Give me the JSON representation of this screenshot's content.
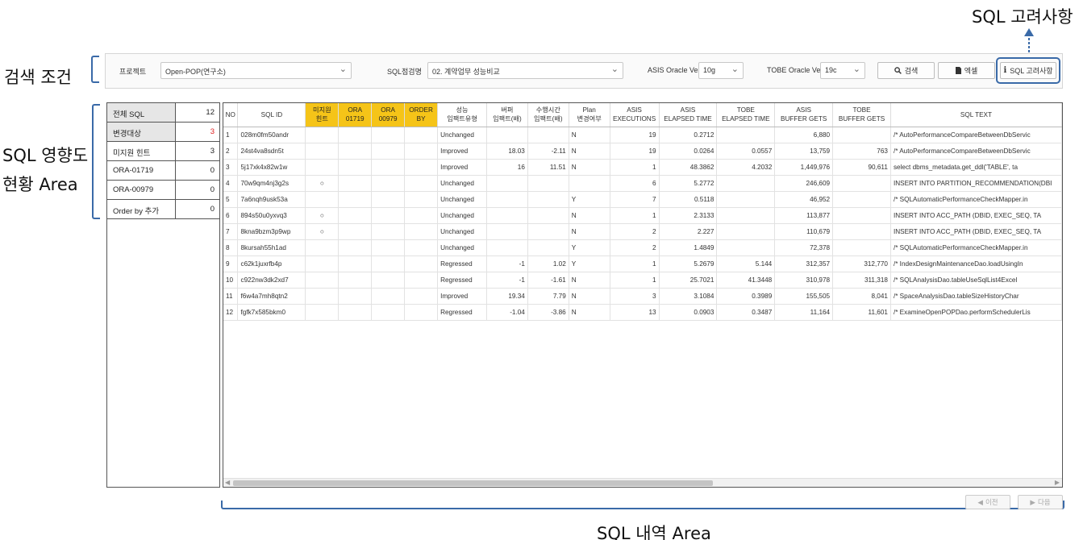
{
  "annotations": {
    "search_condition": "검색 조건",
    "sql_impact_line1": "SQL 영향도",
    "sql_impact_line2": "현황 Area",
    "sql_history": "SQL 내역 Area",
    "sql_considerations": "SQL 고려사항"
  },
  "search": {
    "project_label": "프로젝트",
    "project_value": "Open-POP(연구소)",
    "sql_check_label": "SQL점검명",
    "sql_check_value": "02. 계약업무 성능비교",
    "asis_label": "ASIS Oracle Ver.",
    "asis_value": "10g",
    "tobe_label": "TOBE Oracle Ver.",
    "tobe_value": "19c",
    "search_button": "검색",
    "excel_button": "엑셀",
    "considerations_button": "SQL 고려사항"
  },
  "summary": [
    {
      "label": "전체 SQL",
      "count": "12",
      "highlight": true,
      "count_color": "#222222"
    },
    {
      "label": "변경대상",
      "count": "3",
      "highlight": true,
      "count_color": "#e02020"
    },
    {
      "label": "미지원 힌트",
      "count": "3",
      "highlight": false,
      "count_color": "#222222"
    },
    {
      "label": "ORA-01719",
      "count": "0",
      "highlight": false,
      "count_color": "#222222"
    },
    {
      "label": "ORA-00979",
      "count": "0",
      "highlight": false,
      "count_color": "#222222"
    },
    {
      "label": "Order by 추가",
      "count": "0",
      "highlight": false,
      "count_color": "#222222"
    }
  ],
  "table": {
    "header_accent": "#f5c418",
    "columns": [
      {
        "line1": "NO",
        "line2": "",
        "highlight": false
      },
      {
        "line1": "SQL ID",
        "line2": "",
        "highlight": false
      },
      {
        "line1": "미지원",
        "line2": "힌트",
        "highlight": true
      },
      {
        "line1": "ORA",
        "line2": "01719",
        "highlight": true
      },
      {
        "line1": "ORA",
        "line2": "00979",
        "highlight": true
      },
      {
        "line1": "ORDER",
        "line2": "BY",
        "highlight": true
      },
      {
        "line1": "성능",
        "line2": "임팩트유형",
        "highlight": false
      },
      {
        "line1": "버퍼",
        "line2": "임팩트(배)",
        "highlight": false
      },
      {
        "line1": "수행시간",
        "line2": "임팩트(배)",
        "highlight": false
      },
      {
        "line1": "Plan",
        "line2": "변경여부",
        "highlight": false
      },
      {
        "line1": "ASIS",
        "line2": "EXECUTIONS",
        "highlight": false
      },
      {
        "line1": "ASIS",
        "line2": "ELAPSED TIME",
        "highlight": false
      },
      {
        "line1": "TOBE",
        "line2": "ELAPSED TIME",
        "highlight": false
      },
      {
        "line1": "ASIS",
        "line2": "BUFFER GETS",
        "highlight": false
      },
      {
        "line1": "TOBE",
        "line2": "BUFFER GETS",
        "highlight": false
      },
      {
        "line1": "SQL TEXT",
        "line2": "",
        "highlight": false
      }
    ],
    "rows": [
      [
        "1",
        "028m0fm50andr",
        "",
        "",
        "",
        "",
        "Unchanged",
        "",
        "",
        "N",
        "19",
        "0.2712",
        "",
        "6,880",
        "",
        "/* AutoPerformanceCompareBetweenDbServic"
      ],
      [
        "2",
        "24st4va8sdn5t",
        "",
        "",
        "",
        "",
        "Improved",
        "18.03",
        "-2.11",
        "N",
        "19",
        "0.0264",
        "0.0557",
        "13,759",
        "763",
        "/* AutoPerformanceCompareBetweenDbServic"
      ],
      [
        "3",
        "5j17xk4x82w1w",
        "",
        "",
        "",
        "",
        "Improved",
        "16",
        "11.51",
        "N",
        "1",
        "48.3862",
        "4.2032",
        "1,449,976",
        "90,611",
        "select dbms_metadata.get_ddl('TABLE', ta"
      ],
      [
        "4",
        "70w9qm4nj3g2s",
        "○",
        "",
        "",
        "",
        "Unchanged",
        "",
        "",
        "",
        "6",
        "5.2772",
        "",
        "246,609",
        "",
        "INSERT INTO PARTITION_RECOMMENDATION(DBI"
      ],
      [
        "5",
        "7a6nqh9usk53a",
        "",
        "",
        "",
        "",
        "Unchanged",
        "",
        "",
        "Y",
        "7",
        "0.5118",
        "",
        "46,952",
        "",
        "/* SQLAutomaticPerformanceCheckMapper.in"
      ],
      [
        "6",
        "894s50u0yxvq3",
        "○",
        "",
        "",
        "",
        "Unchanged",
        "",
        "",
        "N",
        "1",
        "2.3133",
        "",
        "113,877",
        "",
        "INSERT INTO ACC_PATH (DBID, EXEC_SEQ, TA"
      ],
      [
        "7",
        "8kna9bzm3p9wp",
        "○",
        "",
        "",
        "",
        "Unchanged",
        "",
        "",
        "N",
        "2",
        "2.227",
        "",
        "110,679",
        "",
        "INSERT INTO ACC_PATH (DBID, EXEC_SEQ, TA"
      ],
      [
        "8",
        "8kursah55h1ad",
        "",
        "",
        "",
        "",
        "Unchanged",
        "",
        "",
        "Y",
        "2",
        "1.4849",
        "",
        "72,378",
        "",
        "/* SQLAutomaticPerformanceCheckMapper.in"
      ],
      [
        "9",
        "c62k1juxrfb4p",
        "",
        "",
        "",
        "",
        "Regressed",
        "-1",
        "1.02",
        "Y",
        "1",
        "5.2679",
        "5.144",
        "312,357",
        "312,770",
        "/* IndexDesignMaintenanceDao.loadUsingIn"
      ],
      [
        "10",
        "c922nw3dk2xd7",
        "",
        "",
        "",
        "",
        "Regressed",
        "-1",
        "-1.61",
        "N",
        "1",
        "25.7021",
        "41.3448",
        "310,978",
        "311,318",
        "/* SQLAnalysisDao.tableUseSqlList4Excel"
      ],
      [
        "11",
        "f6w4a7mh8qtn2",
        "",
        "",
        "",
        "",
        "Improved",
        "19.34",
        "7.79",
        "N",
        "3",
        "3.1084",
        "0.3989",
        "155,505",
        "8,041",
        "/* SpaceAnalysisDao.tableSizeHistoryChar"
      ],
      [
        "12",
        "fgfk7x585bkm0",
        "",
        "",
        "",
        "",
        "Regressed",
        "-1.04",
        "-3.86",
        "N",
        "13",
        "0.0903",
        "0.3487",
        "11,164",
        "11,601",
        "/* ExamineOpenPOPDao.performSchedulerLis"
      ]
    ]
  },
  "pagination": {
    "prev": "이전",
    "next": "다음"
  }
}
